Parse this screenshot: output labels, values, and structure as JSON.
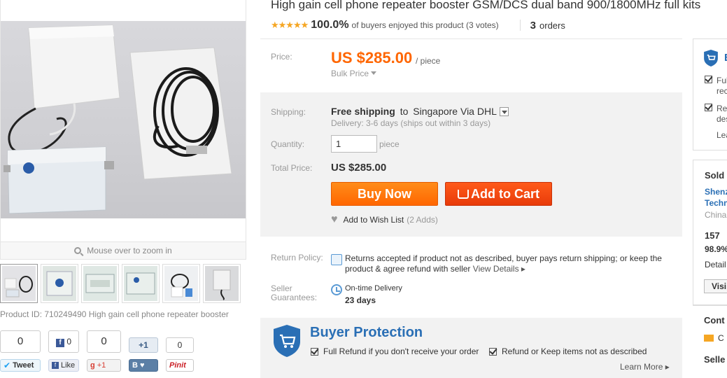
{
  "title": "High gain cell phone repeater booster GSM/DCS dual band 900/1800MHz full kits",
  "rating": {
    "stars": "★★★★★",
    "percent": "100.0%",
    "text": "of buyers enjoyed this product (3 votes)",
    "orders_count": "3",
    "orders_label": "orders"
  },
  "price": {
    "label": "Price:",
    "value": "US $285.00",
    "unit": "/ piece",
    "bulk": "Bulk Price"
  },
  "shipping": {
    "label": "Shipping:",
    "free": "Free shipping",
    "to": "to",
    "dest": "Singapore Via DHL",
    "delivery": "Delivery: 3-6 days (ships out within 3 days)"
  },
  "quantity": {
    "label": "Quantity:",
    "value": "1",
    "unit": "piece"
  },
  "total": {
    "label": "Total Price:",
    "value": "US $285.00"
  },
  "buttons": {
    "buy_now": "Buy Now",
    "add_to_cart": "Add to Cart",
    "wish": "Add to Wish List",
    "wish_count": "(2 Adds)"
  },
  "return_policy": {
    "label": "Return Policy:",
    "text": "Returns accepted if product not as described, buyer pays return shipping; or keep the product & agree refund with seller",
    "link": "View Details ▸"
  },
  "seller_guarantees": {
    "label_line1": "Seller",
    "label_line2": "Guarantees:",
    "ontime": "On-time Delivery",
    "days": "23 days"
  },
  "buyer_protection": {
    "title": "Buyer Protection",
    "item1": "Full Refund if you don't receive your order",
    "item2": "Refund or Keep items not as described",
    "learn_more": "Learn More ▸"
  },
  "gallery": {
    "zoom_hint": "Mouse over to zoom in",
    "product_id": "Product ID: 710249490 High gain cell phone repeater booster"
  },
  "social": {
    "tweet_count": "0",
    "tweet": "Tweet",
    "fb_count": "0",
    "fb_like": "Like",
    "gplus_count": "0",
    "gplus": "+1",
    "vk_count": "+1",
    "pin_count": "0",
    "pin": "Pinit"
  },
  "right_panel": {
    "bp_initial": "B",
    "item1_a": "Ful",
    "item1_b": "rec",
    "item2_a": "Re",
    "item2_b": "des",
    "learn": "Lea",
    "sold_by": "Sold",
    "shop_a": "Shenz",
    "shop_b": "Techn",
    "country": "China",
    "score": "157",
    "feedback": "98.9%",
    "detail": "Detail",
    "visit": "Visi",
    "contact": "Cont",
    "contact_c": "C",
    "seller": "Selle"
  }
}
